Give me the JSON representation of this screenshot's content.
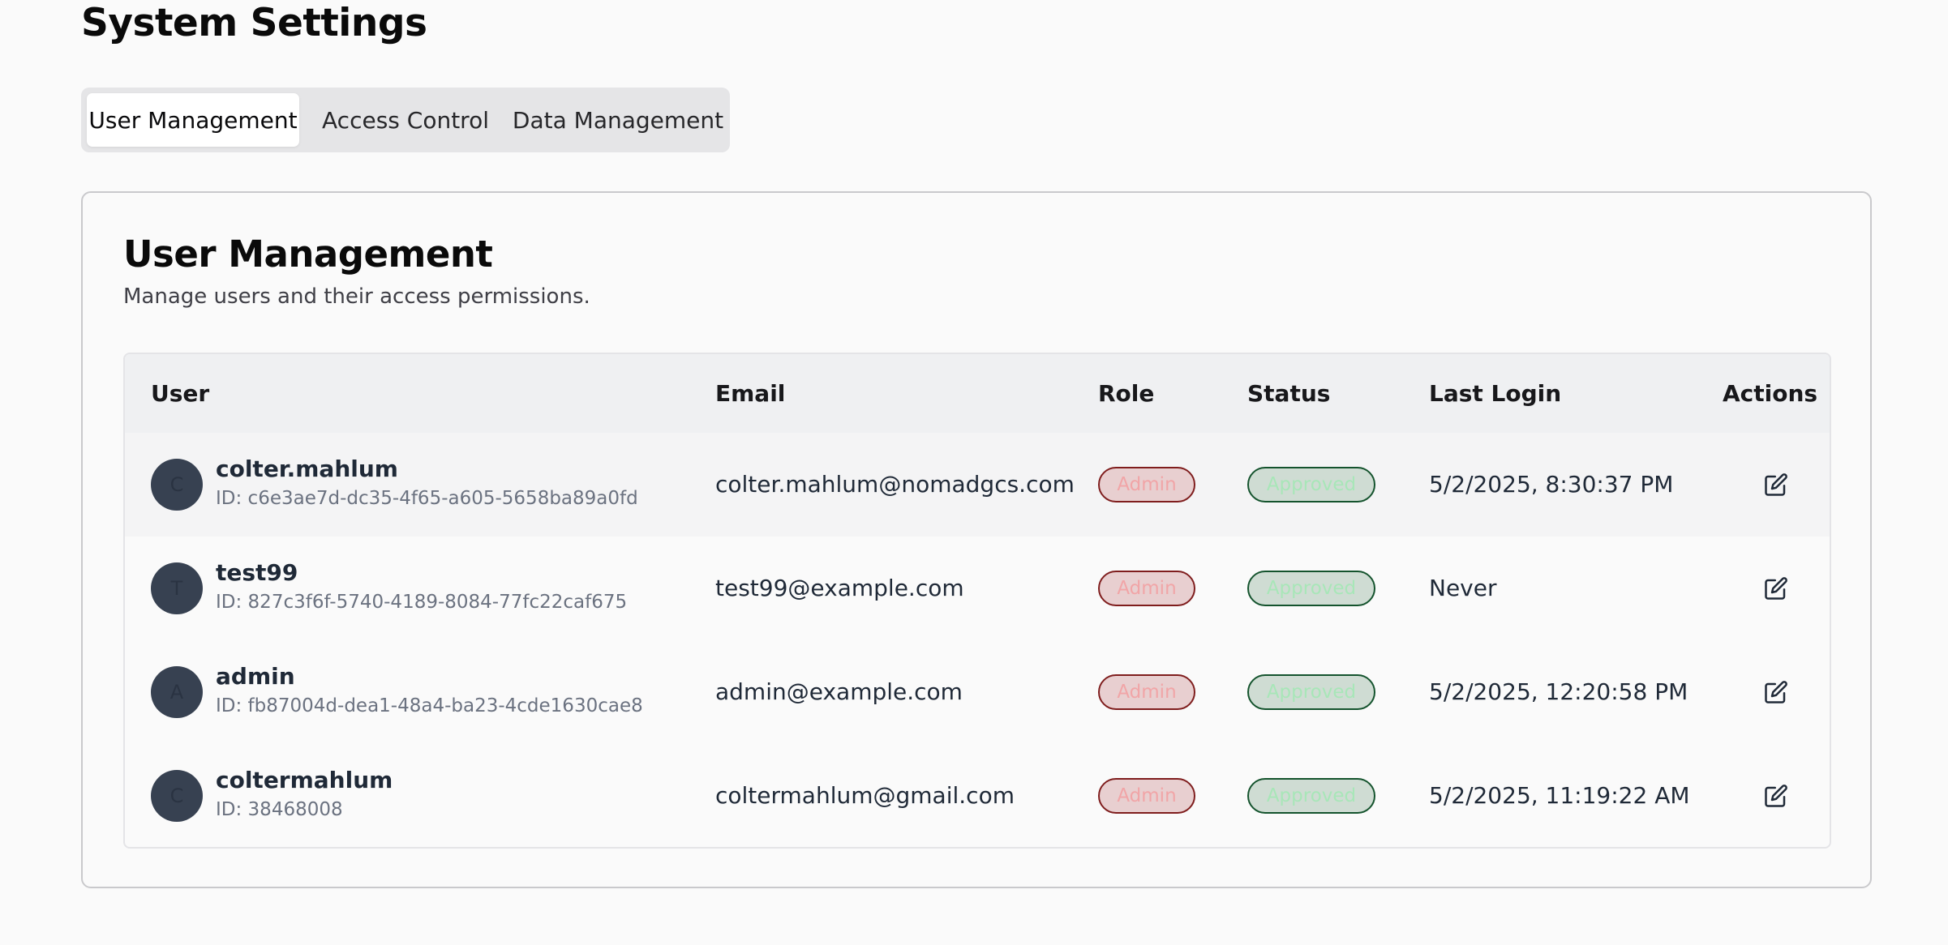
{
  "page": {
    "title": "System Settings"
  },
  "tabs": [
    {
      "label": "User Management",
      "active": true
    },
    {
      "label": "Access Control",
      "active": false
    },
    {
      "label": "Data Management",
      "active": false
    }
  ],
  "card": {
    "title": "User Management",
    "description": "Manage users and their access permissions."
  },
  "table": {
    "headers": {
      "user": "User",
      "email": "Email",
      "role": "Role",
      "status": "Status",
      "last_login": "Last Login",
      "actions": "Actions"
    },
    "rows": [
      {
        "initial": "C",
        "name": "colter.mahlum",
        "id": "ID: c6e3ae7d-dc35-4f65-a605-5658ba89a0fd",
        "email": "colter.mahlum@nomadgcs.com",
        "role": "Admin",
        "status": "Approved",
        "last_login": "5/2/2025, 8:30:37 PM"
      },
      {
        "initial": "T",
        "name": "test99",
        "id": "ID: 827c3f6f-5740-4189-8084-77fc22caf675",
        "email": "test99@example.com",
        "role": "Admin",
        "status": "Approved",
        "last_login": "Never"
      },
      {
        "initial": "A",
        "name": "admin",
        "id": "ID: fb87004d-dea1-48a4-ba23-4cde1630cae8",
        "email": "admin@example.com",
        "role": "Admin",
        "status": "Approved",
        "last_login": "5/2/2025, 12:20:58 PM"
      },
      {
        "initial": "C",
        "name": "coltermahlum",
        "id": "ID: 38468008",
        "email": "coltermahlum@gmail.com",
        "role": "Admin",
        "status": "Approved",
        "last_login": "5/2/2025, 11:19:22 AM"
      }
    ]
  },
  "icons": {
    "edit": "edit-icon"
  },
  "colors": {
    "role_badge_border": "#7f1d1d",
    "status_badge_border": "#14532d",
    "avatar_bg": "#374151"
  }
}
